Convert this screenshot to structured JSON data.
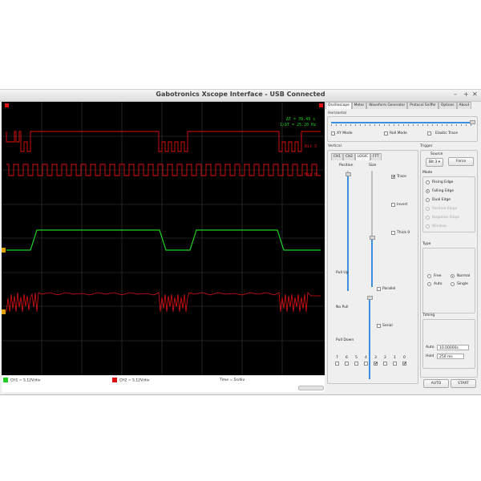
{
  "window": {
    "title": "Gabotronics Xscope Interface - USB Connected",
    "controls": [
      "–",
      "+",
      "✕"
    ]
  },
  "scope": {
    "readouts": [
      "ΔT = 39.49 s",
      "1/ΔT = 25.20 Hz"
    ],
    "channel_labels": [
      "Bit 3",
      "Bit 0"
    ],
    "status": {
      "ch1": "CH1 = 5.12V/div",
      "ch2": "CH2 = 5.12V/div",
      "time": "Time = 5s/div"
    },
    "colors": {
      "ch1": "#22d11e",
      "ch2": "#e01010",
      "grid": "#3c3c3c"
    }
  },
  "panel": {
    "tabs": [
      "Oscilloscope",
      "Meter",
      "Waveform Generator",
      "Protocol Sniffer",
      "Options",
      "About"
    ],
    "active_tab": "Oscilloscope",
    "horizontal": {
      "title": "Horizontal",
      "options": [
        "XY Mode",
        "Roll Mode",
        "Elastic Trace"
      ]
    },
    "vertical": {
      "title": "Vertical",
      "tabs": [
        "CH1",
        "CH2",
        "LOGIC",
        "FFT"
      ],
      "active_tab": "LOGIC",
      "column_labels": [
        "Position",
        "Size"
      ],
      "checks": [
        "Trace",
        "Invert",
        "Thick 0",
        "Parallel",
        "Serial"
      ],
      "pull_labels": [
        "Pull Up",
        "No Pull",
        "Pull Down"
      ],
      "bits": [
        "7",
        "6",
        "5",
        "4",
        "3",
        "2",
        "1",
        "0"
      ]
    },
    "trigger": {
      "title": "Trigger",
      "source_label": "Source",
      "source_value": "Bit 3",
      "force_label": "Force",
      "mode_label": "Mode",
      "modes": [
        "Rising Edge",
        "Falling Edge",
        "Dual Edge",
        "Positive Slope",
        "Negative Slope",
        "Window"
      ],
      "type_label": "Type",
      "types": [
        "Free",
        "Normal",
        "Auto",
        "Single"
      ],
      "timing_label": "Timing",
      "auto_label": "Auto",
      "auto_value": "10.00000s",
      "hold_label": "Hold",
      "hold_value": "250 ms"
    },
    "buttons": {
      "auto": "AUTO",
      "start": "START"
    }
  }
}
